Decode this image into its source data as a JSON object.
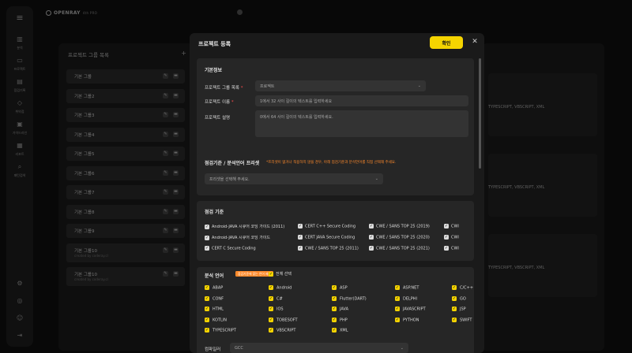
{
  "topbar": {
    "logo": "OPENRAY",
    "logo_pro": "4th PRO"
  },
  "sidebar": {
    "items": [
      {
        "icon": "bar-chart-icon",
        "glyph": "▥",
        "label": "분석"
      },
      {
        "icon": "folder-icon",
        "glyph": "▭",
        "label": "프로젝트"
      },
      {
        "icon": "document-icon",
        "glyph": "▤",
        "label": "점검기록"
      },
      {
        "icon": "shield-icon",
        "glyph": "◇",
        "label": "취약점"
      },
      {
        "icon": "book-icon",
        "glyph": "▣",
        "label": "가이드라인"
      },
      {
        "icon": "report-icon",
        "glyph": "▦",
        "label": "리포트"
      },
      {
        "icon": "search-icon",
        "glyph": "⌕",
        "label": "패턴검색"
      }
    ],
    "bottom": [
      {
        "icon": "settings-icon",
        "glyph": "⚙"
      },
      {
        "icon": "globe-icon",
        "glyph": "◎"
      },
      {
        "icon": "user-icon",
        "glyph": "☺"
      },
      {
        "icon": "logout-icon",
        "glyph": "⇥"
      }
    ]
  },
  "group_panel": {
    "title": "프로젝트 그룹 목록",
    "add": "+",
    "rows": [
      {
        "name": "기본 그룹"
      },
      {
        "name": "기본 그룹2"
      },
      {
        "name": "기본 그룹3"
      },
      {
        "name": "기본 그룹4"
      },
      {
        "name": "기본 그룹5"
      },
      {
        "name": "기본 그룹6"
      },
      {
        "name": "기본 그룹7"
      },
      {
        "name": "기본 그룹8"
      },
      {
        "name": "기본 그룹9"
      },
      {
        "name": "기본 그룹10",
        "sub": "created by coderay.cl"
      },
      {
        "name": "기본 그룹10",
        "sub": "created by coderay.cl"
      }
    ]
  },
  "right_panel": {
    "card_text": "TYPESCRIPT, VBSCRIPT, XML"
  },
  "modal": {
    "title": "프로젝트 등록",
    "confirm": "확인",
    "close": "✕",
    "basic": {
      "title": "기본정보",
      "group_label": "프로젝트 그룹 목록",
      "group_value": "프로젝트",
      "name_label": "프로젝트 이름",
      "name_placeholder": "1에서 32 사이 길이의 텍스트를 입력하세요",
      "desc_label": "프로젝트 설명",
      "desc_placeholder": "0에서 64 사이 길이의 텍스트를 입력하세요."
    },
    "preset": {
      "title": "점검기준 / 분석언어 프리셋",
      "hint": "*프리셋이 없거나 적용하지 않을 경우, 아래 점검기준과 분석언어를 직접 선택해 주세요.",
      "placeholder": "프리셋을 선택해 주세요."
    },
    "criteria": {
      "title": "점검 기준",
      "items": [
        "Android-JAVA 시큐어 코딩 가이드 (2011)",
        "CERT C++ Secure Coding",
        "CWE / SANS TOP 25 (2019)",
        "CWI",
        "Android-JAVA 시큐어 코딩 가이드",
        "CERT JAVA Secure Coding",
        "CWE / SANS TOP 25 (2020)",
        "CWI",
        "CERT C Secure Coding",
        "CWE / SANS TOP 25 (2011)",
        "CWE / SANS TOP 25 (2021)",
        "CWI"
      ]
    },
    "languages": {
      "title": "분석 언어",
      "tag": "점검기준에 맞는 언어 제공",
      "select_all": "전체 선택",
      "items": [
        "ABAP",
        "Android",
        "ASP",
        "ASP.NET",
        "C/C++",
        "CONF",
        "C#",
        "Flutter(DART)",
        "DELPHI",
        "GO",
        "HTML",
        "IOS",
        "JAVA",
        "JAVASCRIPT",
        "JSP",
        "KOTLIN",
        "TOBESOFT",
        "PHP",
        "PYTHON",
        "SWIFT",
        "TYPESCRIPT",
        "VBSCRIPT",
        "XML"
      ],
      "compiler_label": "컴파일러",
      "compiler_value": "GCC"
    }
  }
}
